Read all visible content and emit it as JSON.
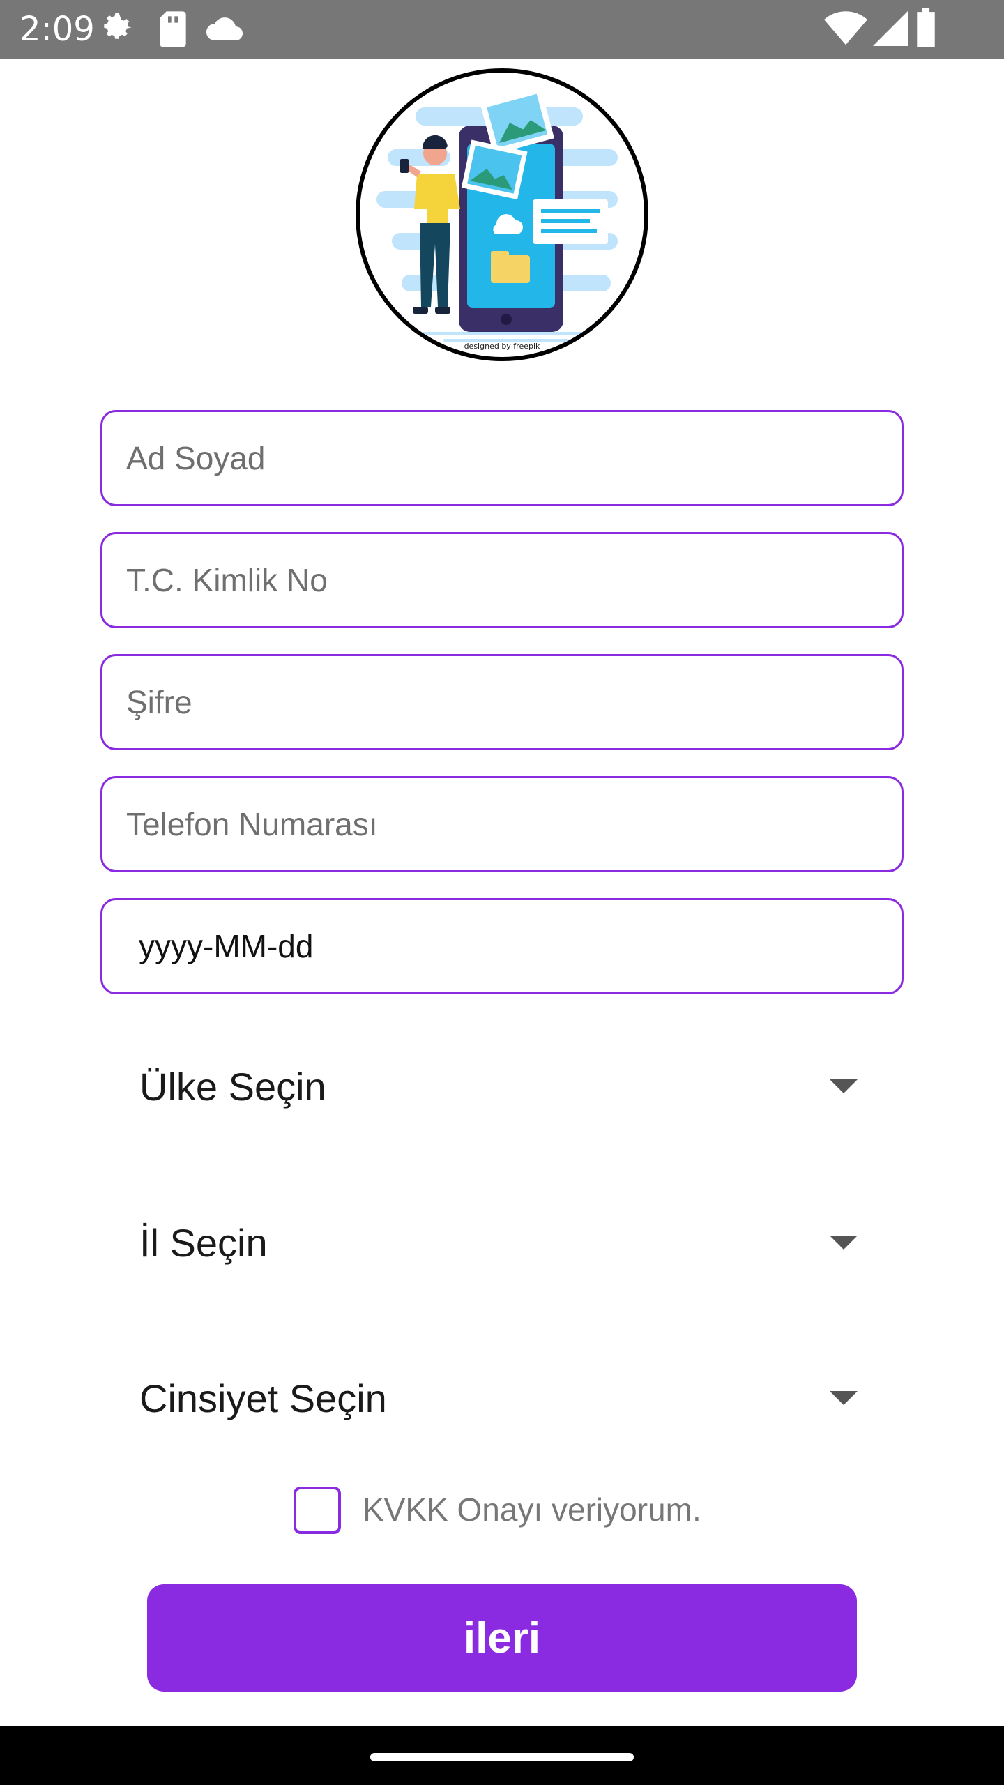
{
  "status_bar": {
    "time": "2:09",
    "left_icons": [
      "settings-icon",
      "sd-card-icon",
      "cloud-icon"
    ],
    "right_icons": [
      "wifi-icon",
      "signal-icon",
      "battery-icon"
    ]
  },
  "avatar": {
    "credit": "designed by freepik"
  },
  "form": {
    "full_name_placeholder": "Ad Soyad",
    "tc_id_placeholder": "T.C. Kimlik No",
    "password_placeholder": "Şifre",
    "phone_placeholder": "Telefon Numarası",
    "birth_date_value": "yyyy-MM-dd",
    "country_label": "Ülke Seçin",
    "city_label": "İl Seçin",
    "gender_label": "Cinsiyet Seçin",
    "kvkk_label": "KVKK Onayı veriyorum.",
    "kvkk_checked": false,
    "next_button": "ileri"
  },
  "colors": {
    "accent": "#8a2be2",
    "status_bar": "#777777",
    "nav_bar": "#000000"
  }
}
